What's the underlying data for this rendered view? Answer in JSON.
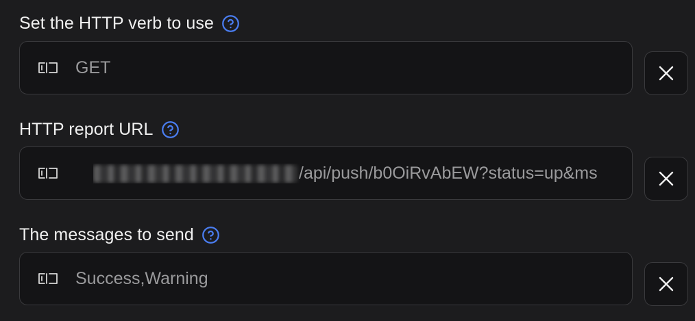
{
  "fields": [
    {
      "label": "Set the HTTP verb to use",
      "value": "GET",
      "has_redacted_prefix": false
    },
    {
      "label": "HTTP report URL",
      "value": "/api/push/b0OiRvAbEW?status=up&ms",
      "has_redacted_prefix": true
    },
    {
      "label": "The messages to send",
      "value": "Success,Warning",
      "has_redacted_prefix": false
    }
  ],
  "icons": {
    "help": "help-circle-icon",
    "input": "text-cursor-input-icon",
    "clear": "close-icon"
  },
  "colors": {
    "accent": "#4a7df0",
    "background": "#1c1c1e",
    "input_background": "#141416",
    "border": "#3a3a3d",
    "label_text": "#f0f0f0",
    "value_text": "#9a9a9c"
  }
}
